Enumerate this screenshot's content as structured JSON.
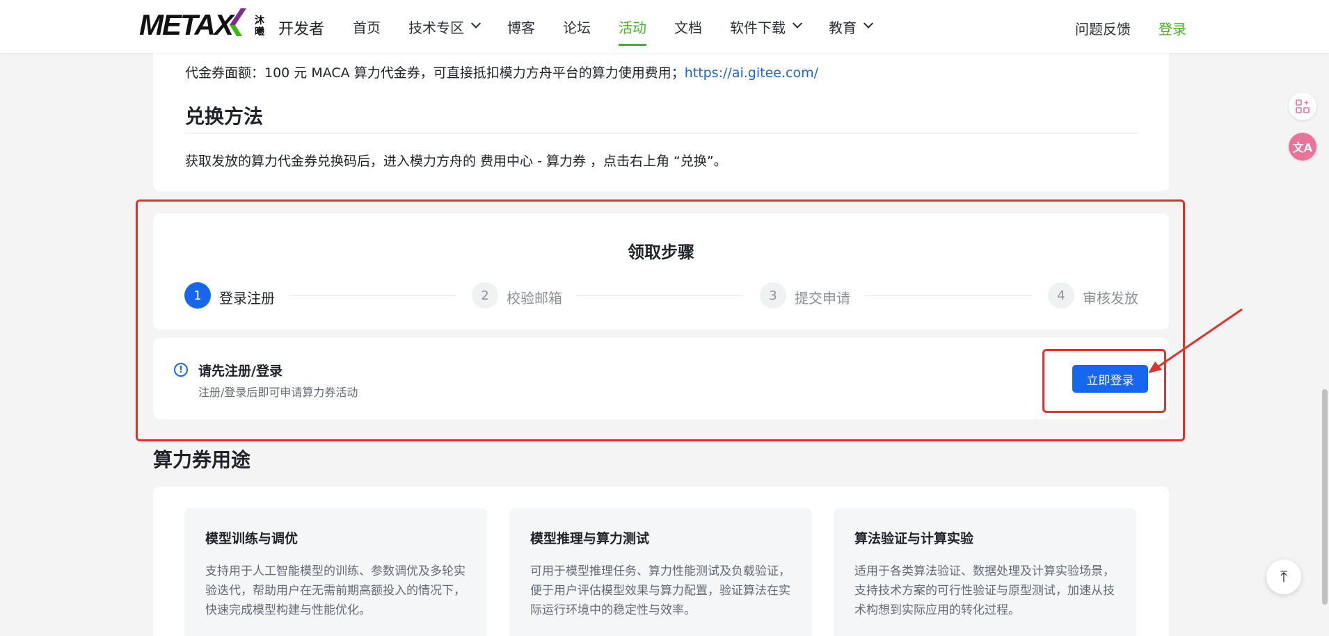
{
  "header": {
    "logo_text": "METAX",
    "logo_cn": "沐曦",
    "brand_suffix": "开发者",
    "nav": [
      {
        "label": "首页",
        "dropdown": false,
        "active": false
      },
      {
        "label": "技术专区",
        "dropdown": true,
        "active": false
      },
      {
        "label": "博客",
        "dropdown": false,
        "active": false
      },
      {
        "label": "论坛",
        "dropdown": false,
        "active": false
      },
      {
        "label": "活动",
        "dropdown": false,
        "active": true
      },
      {
        "label": "文档",
        "dropdown": false,
        "active": false
      },
      {
        "label": "软件下载",
        "dropdown": true,
        "active": false
      },
      {
        "label": "教育",
        "dropdown": true,
        "active": false
      }
    ],
    "feedback": "问题反馈",
    "login": "登录"
  },
  "voucher": {
    "text": "代金券面额：100 元 MACA 算力代金券，可直接抵扣模力方舟平台的算力使用费用；",
    "link": "https://ai.gitee.com/"
  },
  "exchange": {
    "title": "兑换方法",
    "desc": "获取发放的算力代金券兑换码后，进入模力方舟的 费用中心 - 算力券 ，点击右上角 “兑换”。"
  },
  "steps": {
    "title": "领取步骤",
    "items": [
      {
        "num": "1",
        "label": "登录注册",
        "active": true
      },
      {
        "num": "2",
        "label": "校验邮箱",
        "active": false
      },
      {
        "num": "3",
        "label": "提交申请",
        "active": false
      },
      {
        "num": "4",
        "label": "审核发放",
        "active": false
      }
    ]
  },
  "notice": {
    "icon": "!",
    "title": "请先注册/登录",
    "subtitle": "注册/登录后即可申请算力券活动",
    "button": "立即登录"
  },
  "usage": {
    "title": "算力券用途",
    "items": [
      {
        "title": "模型训练与调优",
        "desc": "支持用于人工智能模型的训练、参数调优及多轮实验迭代，帮助用户在无需前期高额投入的情况下，快速完成模型构建与性能优化。"
      },
      {
        "title": "模型推理与算力测试",
        "desc": "可用于模型推理任务、算力性能测试及负载验证，便于用户评估模型效果与算力配置，验证算法在实际运行环境中的稳定性与效率。"
      },
      {
        "title": "算法验证与计算实验",
        "desc": "适用于各类算法验证、数据处理及计算实验场景，支持技术方案的可行性验证与原型测试，加速从技术构想到实际应用的转化过程。"
      }
    ]
  },
  "floating": {
    "translate_glyph": "文A",
    "back_top_glyph": "⤒"
  },
  "colors": {
    "accent_green": "#3fb618",
    "primary_blue": "#1766f0",
    "annotation_red": "#e0322b",
    "link_blue": "#1a66d6"
  }
}
